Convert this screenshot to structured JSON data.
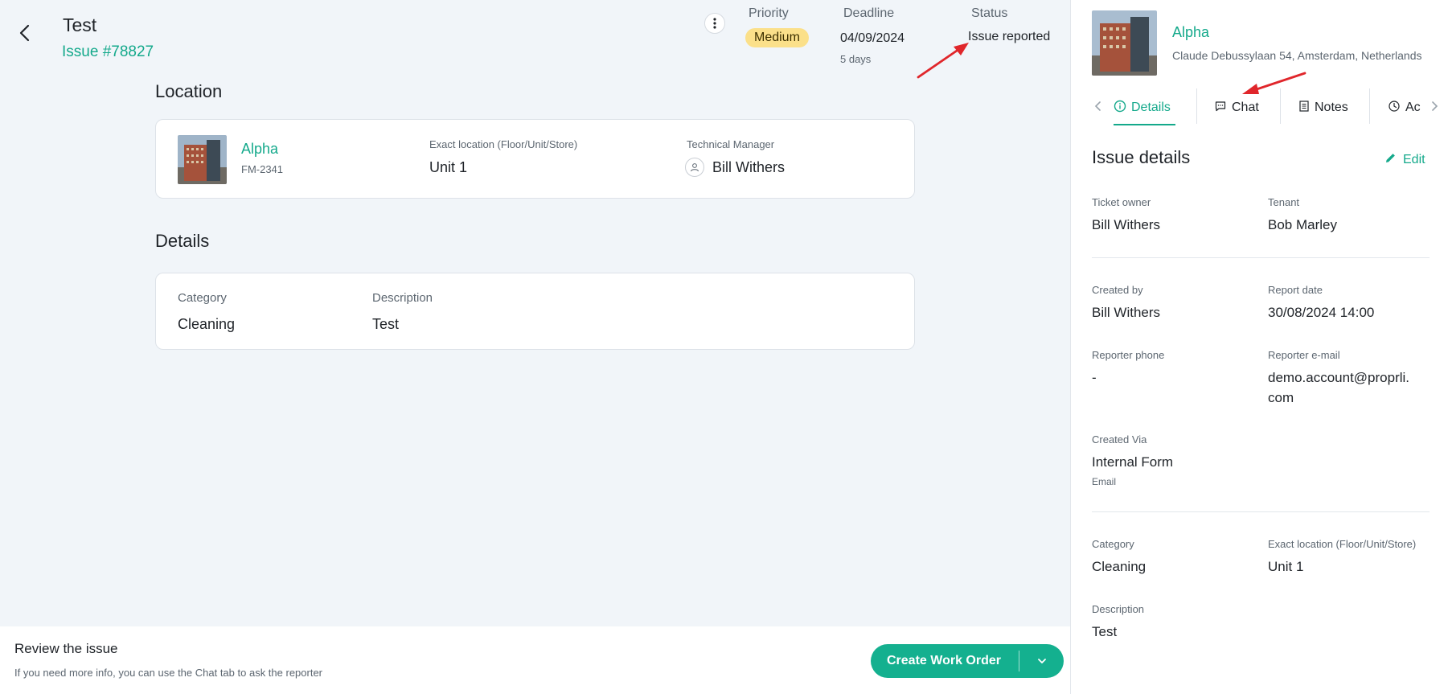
{
  "header": {
    "title": "Test",
    "issue_number": "Issue #78827",
    "priority_label": "Priority",
    "priority_value": "Medium",
    "deadline_label": "Deadline",
    "deadline_value": "04/09/2024",
    "deadline_sub": "5 days",
    "status_label": "Status",
    "status_value": "Issue reported"
  },
  "location_section": {
    "title": "Location",
    "property_name": "Alpha",
    "property_code": "FM-2341",
    "exact_location_label": "Exact location (Floor/Unit/Store)",
    "exact_location_value": "Unit 1",
    "manager_label": "Technical Manager",
    "manager_value": "Bill Withers"
  },
  "details_section": {
    "title": "Details",
    "category_label": "Category",
    "category_value": "Cleaning",
    "description_label": "Description",
    "description_value": "Test"
  },
  "footer": {
    "title": "Review the issue",
    "subtitle": "If you need more info, you can use the Chat tab to ask the reporter",
    "cta_label": "Create Work Order"
  },
  "sidebar": {
    "property_name": "Alpha",
    "property_address": "Claude Debussylaan 54, Amsterdam, Netherlands",
    "tabs": [
      {
        "label": "Details",
        "icon": "info-icon",
        "active": true
      },
      {
        "label": "Chat",
        "icon": "chat-icon",
        "active": false
      },
      {
        "label": "Notes",
        "icon": "notes-icon",
        "active": false
      },
      {
        "label": "Ac",
        "icon": "clock-icon",
        "active": false
      }
    ],
    "section_title": "Issue details",
    "edit_label": "Edit",
    "fields": {
      "ticket_owner_label": "Ticket owner",
      "ticket_owner_value": "Bill Withers",
      "tenant_label": "Tenant",
      "tenant_value": "Bob Marley",
      "created_by_label": "Created by",
      "created_by_value": "Bill Withers",
      "report_date_label": "Report date",
      "report_date_value": "30/08/2024 14:00",
      "reporter_phone_label": "Reporter phone",
      "reporter_phone_value": "-",
      "reporter_email_label": "Reporter e-mail",
      "reporter_email_line1": "demo.account@proprli.",
      "reporter_email_line2": "com",
      "created_via_label": "Created Via",
      "created_via_value": "Internal Form",
      "created_via_sub": "Email",
      "category_label": "Category",
      "category_value": "Cleaning",
      "exact_location_label": "Exact location (Floor/Unit/Store)",
      "exact_location_value": "Unit 1",
      "description_label": "Description",
      "description_value": "Test"
    }
  },
  "colors": {
    "accent": "#14a98b",
    "priority_medium": "#fbe08a",
    "annotation_arrow": "#e0262b"
  }
}
